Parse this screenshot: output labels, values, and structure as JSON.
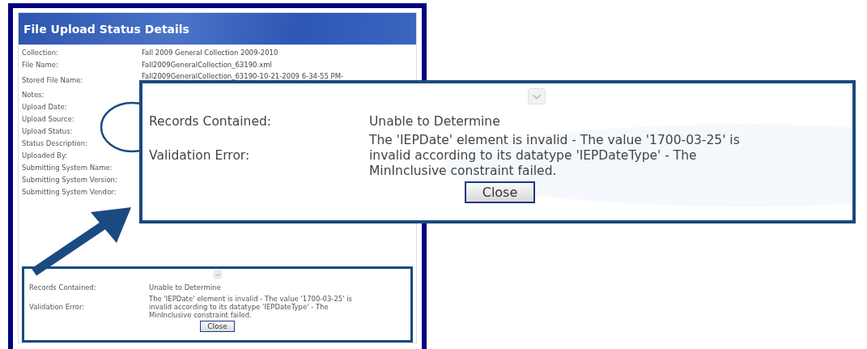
{
  "panel": {
    "title": "File Upload Status Details",
    "fields": [
      {
        "label": "Collection:",
        "value": "Fall 2009 General Collection 2009-2010"
      },
      {
        "label": "File Name:",
        "value": "Fall2009GeneralCollection_63190.xml"
      },
      {
        "label": "Stored File Name:",
        "value": "Fall2009GeneralCollection_63190-10-21-2009 6-34-55 PM-"
      },
      {
        "label": "Notes:"
      },
      {
        "label": "Upload Date:"
      },
      {
        "label": "Upload Source:"
      },
      {
        "label": "Upload Status:"
      },
      {
        "label": "Status Description:"
      },
      {
        "label": "Uploaded By:"
      },
      {
        "label": "Submitting System Name:"
      },
      {
        "label": "Submitting System Version:"
      },
      {
        "label": "Submitting System Vendor:"
      }
    ]
  },
  "error_box": {
    "rows": [
      {
        "label": "Records Contained:",
        "value": "Unable to Determine"
      },
      {
        "label": "Validation Error:",
        "value": "The 'IEPDate' element is invalid - The value '1700-03-25' is invalid according to its datatype 'IEPDateType' - The MinInclusive constraint failed."
      }
    ],
    "button": "Close"
  },
  "callout": {
    "rows": [
      {
        "label": "Records Contained:",
        "value": "Unable to Determine"
      },
      {
        "label": "Validation Error:",
        "value": "The 'IEPDate' element is invalid - The value '1700-03-25' is invalid according to its datatype 'IEPDateType' - The MinInclusive constraint failed."
      }
    ],
    "button": "Close"
  }
}
